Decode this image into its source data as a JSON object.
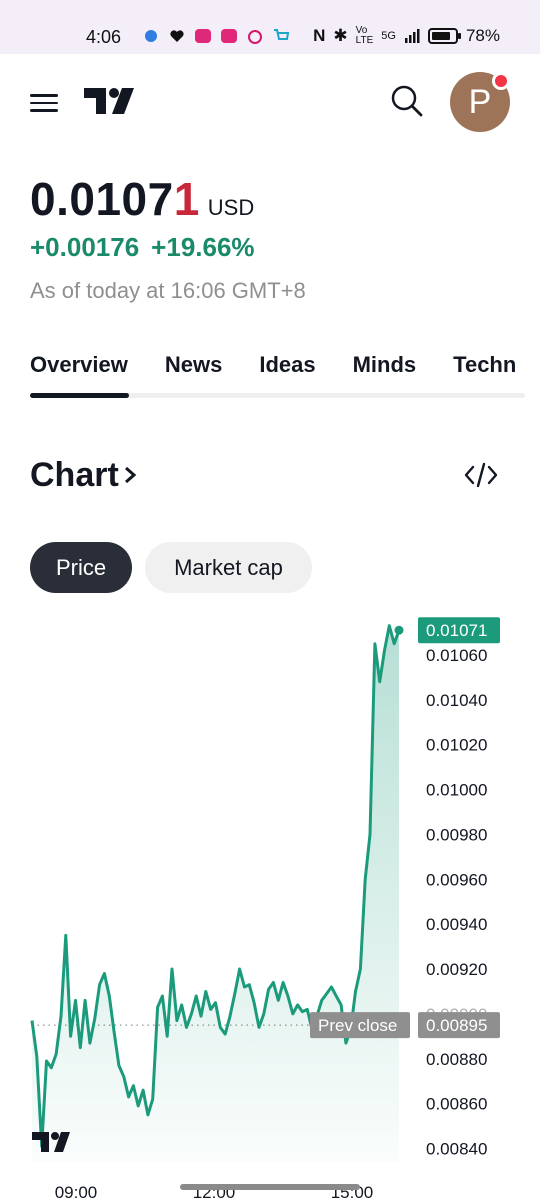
{
  "status_bar": {
    "time": "4:06",
    "battery": "78%",
    "network": "5G"
  },
  "header": {
    "avatar_letter": "P"
  },
  "quote": {
    "price_main": "0.0107",
    "price_last_digit": "1",
    "currency": "USD",
    "change_abs": "+0.00176",
    "change_pct": "+19.66%",
    "as_of": "As of today at 16:06 GMT+8"
  },
  "tabs": [
    {
      "label": "Overview"
    },
    {
      "label": "News"
    },
    {
      "label": "Ideas"
    },
    {
      "label": "Minds"
    },
    {
      "label": "Techn"
    }
  ],
  "chart_section": {
    "title": "Chart",
    "pills": [
      {
        "label": "Price"
      },
      {
        "label": "Market cap"
      }
    ]
  },
  "colors": {
    "accent_green": "#1b9b7b",
    "price_red": "#c8283a",
    "dark": "#131722"
  },
  "chart_data": {
    "type": "area",
    "x_ticks": [
      "09:00",
      "12:00",
      "15:00"
    ],
    "y_ticks": [
      0.0106,
      0.0104,
      0.0102,
      0.01,
      0.0098,
      0.0096,
      0.0094,
      0.0092,
      0.009,
      0.0088,
      0.0086,
      0.0084
    ],
    "y_tick_labels": [
      "0.01060",
      "0.01040",
      "0.01020",
      "0.01000",
      "0.00980",
      "0.00960",
      "0.00940",
      "0.00920",
      "0.00900",
      "0.00880",
      "0.00860",
      "0.00840"
    ],
    "ylim": [
      0.00834,
      0.01076
    ],
    "last_value": 0.01071,
    "last_value_label": "0.01071",
    "prev_close": 0.00895,
    "prev_close_value_label": "0.00895",
    "prev_close_label": "Prev close",
    "series": [
      {
        "values": [
          0.00897,
          0.00881,
          0.00841,
          0.00879,
          0.00876,
          0.00882,
          0.00899,
          0.00935,
          0.0089,
          0.00906,
          0.00885,
          0.00906,
          0.00887,
          0.00898,
          0.00913,
          0.00918,
          0.00908,
          0.00892,
          0.00877,
          0.00872,
          0.00863,
          0.00868,
          0.00859,
          0.00866,
          0.00855,
          0.00862,
          0.00903,
          0.00908,
          0.0089,
          0.0092,
          0.00897,
          0.00904,
          0.00894,
          0.009,
          0.00908,
          0.00899,
          0.0091,
          0.00902,
          0.00905,
          0.00894,
          0.00891,
          0.00899,
          0.00909,
          0.0092,
          0.00912,
          0.00913,
          0.00905,
          0.00894,
          0.009,
          0.00911,
          0.00914,
          0.00906,
          0.00914,
          0.00908,
          0.009,
          0.00904,
          0.00901,
          0.00902,
          0.00893,
          0.00899,
          0.00906,
          0.00909,
          0.00912,
          0.00908,
          0.00904,
          0.00887,
          0.00893,
          0.0091,
          0.0092,
          0.0096,
          0.0098,
          0.01065,
          0.01048,
          0.01062,
          0.01073,
          0.01065,
          0.01071
        ]
      }
    ]
  }
}
